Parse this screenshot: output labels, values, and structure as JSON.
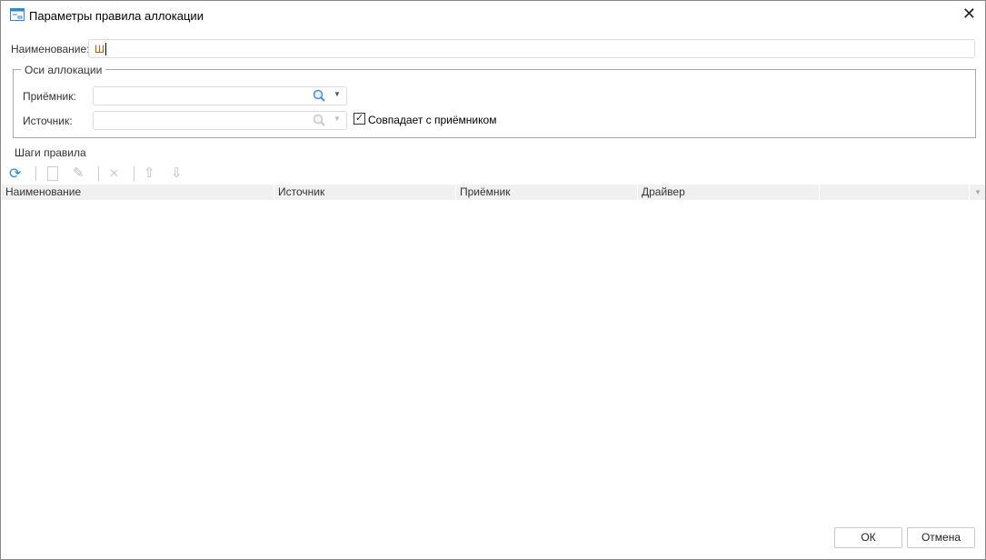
{
  "window": {
    "title": "Параметры правила аллокации"
  },
  "name_field": {
    "label": "Наименование:",
    "value": "Ш"
  },
  "axes": {
    "legend": "Оси аллокации",
    "receiver_label": "Приёмник:",
    "receiver_value": "",
    "source_label": "Источник:",
    "source_value": "",
    "same_checkbox_label": "Совпадает с приёмником",
    "same_checked": true
  },
  "steps": {
    "title": "Шаги правила",
    "columns": [
      "Наименование",
      "Источник",
      "Приёмник",
      "Драйвер",
      ""
    ]
  },
  "buttons": {
    "ok": "ОК",
    "cancel": "Отмена"
  }
}
